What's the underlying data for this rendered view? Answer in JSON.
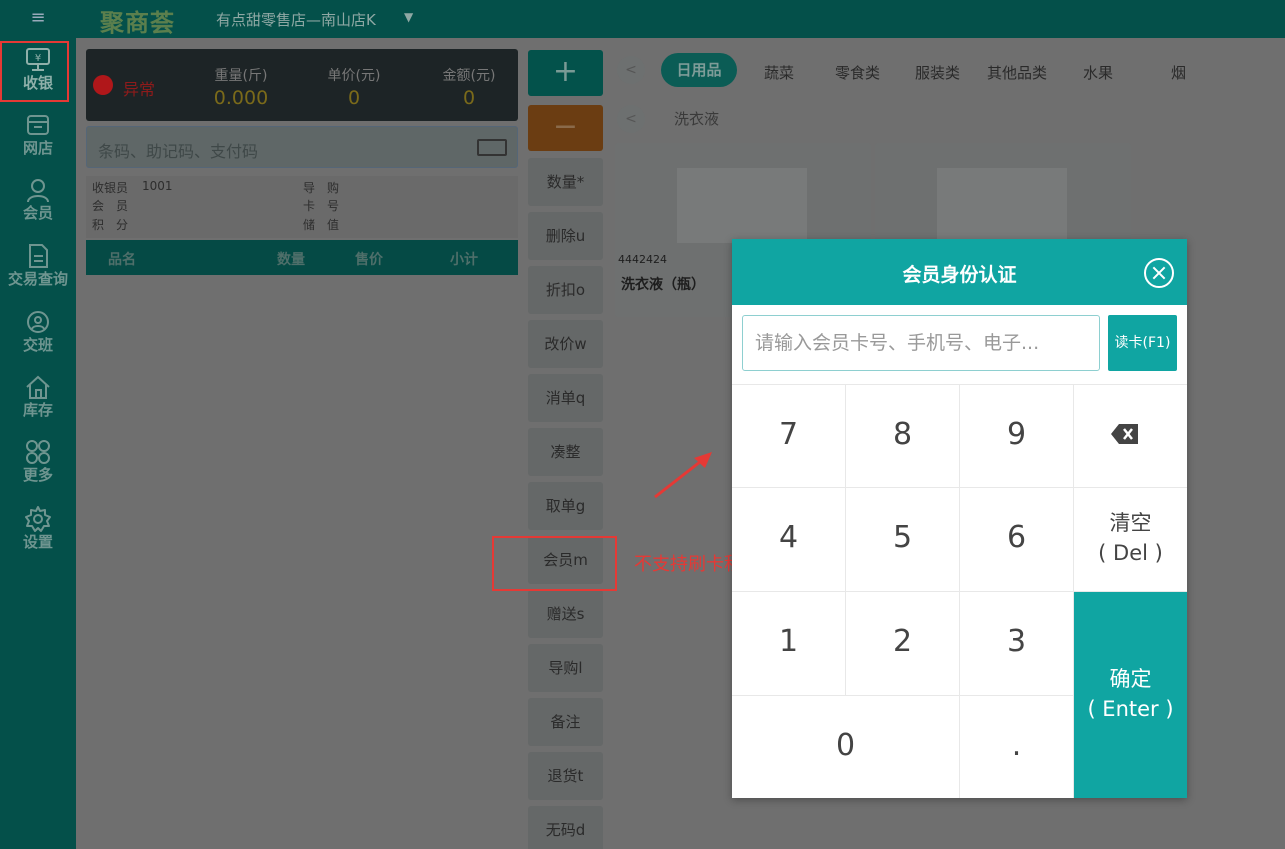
{
  "topbar": {
    "menu_icon": "≡",
    "logo": "聚商荟",
    "store": "有点甜零售店—南山店K",
    "caret": "▼"
  },
  "sidebar": {
    "items": [
      {
        "label": "收银",
        "icon": "cash-register-icon"
      },
      {
        "label": "网店",
        "icon": "store-icon"
      },
      {
        "label": "会员",
        "icon": "user-icon"
      },
      {
        "label": "交易查询",
        "icon": "document-icon"
      },
      {
        "label": "交班",
        "icon": "shift-icon"
      },
      {
        "label": "库存",
        "icon": "home-icon"
      },
      {
        "label": "更多",
        "icon": "grid-icon"
      },
      {
        "label": "设置",
        "icon": "gear-icon"
      }
    ]
  },
  "scale": {
    "status": "异常",
    "weight_label": "重量(斤)",
    "weight_value": "0.000",
    "price_label": "单价(元)",
    "price_value": "0",
    "amount_label": "金额(元)",
    "amount_value": "0"
  },
  "search": {
    "placeholder": "条码、助记码、支付码"
  },
  "info": {
    "cashier_label": "收银员",
    "cashier_value": "1001",
    "member_label": "会　员",
    "points_label": "积　分",
    "guide_label": "导　购",
    "card_label": "卡　号",
    "stored_label": "储　值"
  },
  "table": {
    "headers": [
      "品名",
      "数量",
      "售价",
      "小计"
    ]
  },
  "actions": {
    "plus": "+",
    "minus": "−",
    "buttons": [
      "数量*",
      "删除u",
      "折扣o",
      "改价w",
      "消单q",
      "凑整",
      "取单g",
      "会员m",
      "赠送s",
      "导购l",
      "备注",
      "退货t",
      "无码d"
    ]
  },
  "annotation": {
    "text": "不支持刷卡积分"
  },
  "categories": {
    "tabs": [
      "日用品",
      "蔬菜",
      "零食类",
      "服装类",
      "其他品类",
      "水果",
      "烟"
    ],
    "active": "日用品",
    "subcategory": "洗衣液",
    "nav_left": "<"
  },
  "products": [
    {
      "code": "4442424",
      "name": "洗衣液（瓶）"
    }
  ],
  "modal": {
    "title": "会员身份认证",
    "input_placeholder": "请输入会员卡号、手机号、电子...",
    "read_card": "读卡(F1)",
    "keys": [
      "7",
      "8",
      "9",
      "4",
      "5",
      "6",
      "1",
      "2",
      "3",
      "0",
      "."
    ],
    "clear_line1": "清空",
    "clear_line2": "( Del )",
    "confirm_line1": "确定",
    "confirm_line2": "( Enter )"
  }
}
